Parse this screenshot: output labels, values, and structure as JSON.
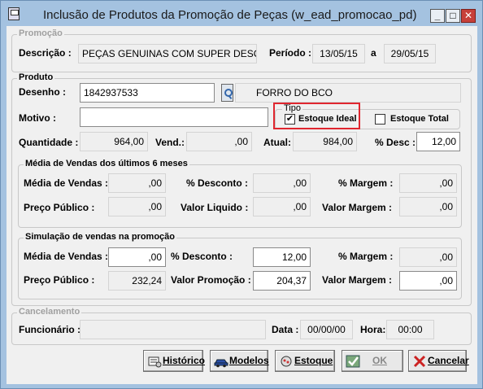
{
  "window": {
    "title": "Inclusão de Produtos da Promoção de Peças (w_ead_promocao_pd)",
    "minimize": "_",
    "maximize": "□",
    "close": "✕"
  },
  "promocao": {
    "caption": "Promoção",
    "descricao_label": "Descrição :",
    "descricao_value": "PEÇAS GENUINAS COM SUPER DESC",
    "periodo_label": "Período :",
    "periodo_inicio": "13/05/15",
    "periodo_sep": "a",
    "periodo_fim": "29/05/15"
  },
  "produto": {
    "caption": "Produto",
    "desenho_label": "Desenho :",
    "desenho_value": "1842937533",
    "descricao_produto": "FORRO DO BCO",
    "motivo_label": "Motivo :",
    "motivo_value": "",
    "tipo": {
      "caption": "Tipo",
      "estoque_ideal_label": "Estoque Ideal",
      "estoque_ideal_checked": true,
      "estoque_total_label": "Estoque Total",
      "estoque_total_checked": false
    },
    "quantidade_label": "Quantidade :",
    "quantidade_value": "964,00",
    "vend_label": "Vend.:",
    "vend_value": ",00",
    "atual_label": "Atual:",
    "atual_value": "984,00",
    "pdesc_label": "% Desc :",
    "pdesc_value": "12,00"
  },
  "media": {
    "caption": "Média de Vendas dos últimos 6 meses",
    "media_vendas_label": "Média de Vendas :",
    "media_vendas_value": ",00",
    "pdesconto_label": "% Desconto :",
    "pdesconto_value": ",00",
    "pmargem_label": "% Margem :",
    "pmargem_value": ",00",
    "preco_publico_label": "Preço Público :",
    "preco_publico_value": ",00",
    "valor_liquido_label": "Valor Liquido :",
    "valor_liquido_value": ",00",
    "valor_margem_label": "Valor Margem :",
    "valor_margem_value": ",00"
  },
  "simulacao": {
    "caption": "Simulação de vendas na promoção",
    "media_vendas_label": "Média de Vendas :",
    "media_vendas_value": ",00",
    "pdesconto_label": "% Desconto :",
    "pdesconto_value": "12,00",
    "pmargem_label": "% Margem :",
    "pmargem_value": ",00",
    "preco_publico_label": "Preço Público :",
    "preco_publico_value": "232,24",
    "valor_promocao_label": "Valor Promoção :",
    "valor_promocao_value": "204,37",
    "valor_margem_label": "Valor Margem :",
    "valor_margem_value": ",00"
  },
  "cancelamento": {
    "caption": "Cancelamento",
    "funcionario_label": "Funcionário :",
    "funcionario_value": "",
    "data_label": "Data :",
    "data_value": "00/00/00",
    "hora_label": "Hora:",
    "hora_value": "00:00"
  },
  "buttons": {
    "historico": "Histórico",
    "modelos": "Modelos",
    "estoque": "Estoque",
    "ok": "OK",
    "cancelar": "Cancelar"
  }
}
